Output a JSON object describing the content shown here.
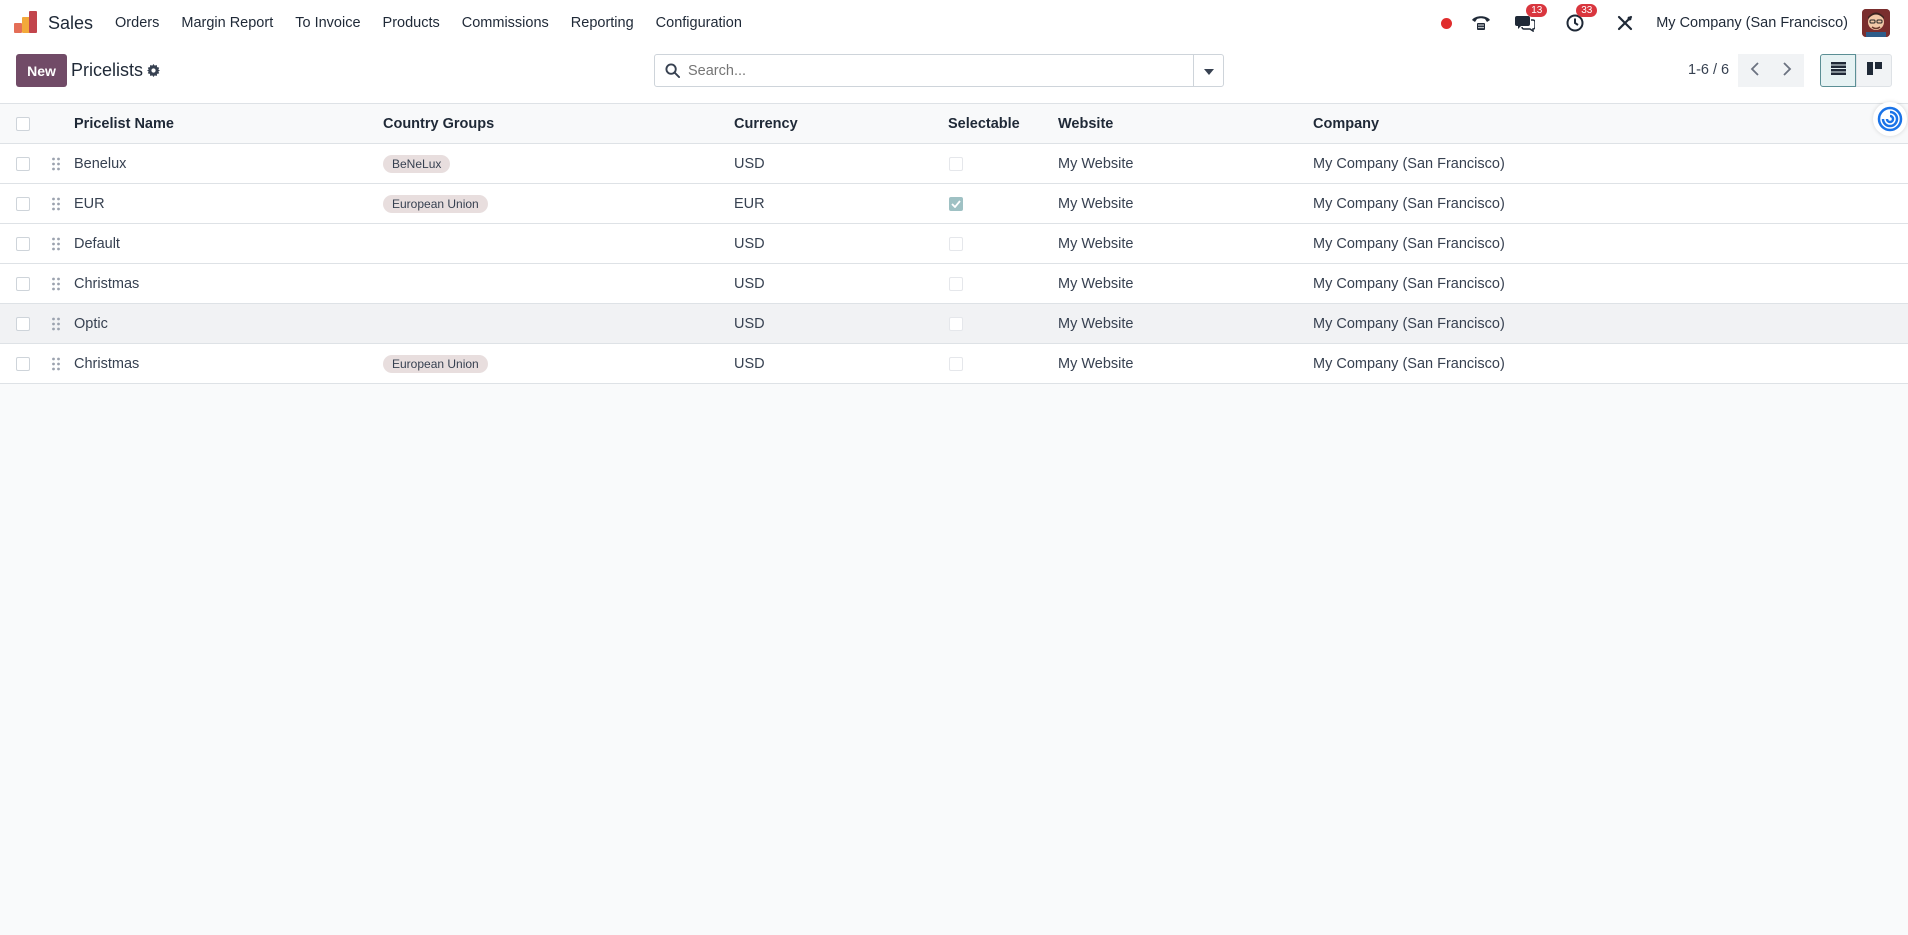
{
  "app": {
    "name": "Sales",
    "logo_icon": "sales-app-logo-icon"
  },
  "menu": [
    {
      "label": "Orders"
    },
    {
      "label": "Margin Report"
    },
    {
      "label": "To Invoice"
    },
    {
      "label": "Products"
    },
    {
      "label": "Commissions"
    },
    {
      "label": "Reporting"
    },
    {
      "label": "Configuration"
    }
  ],
  "systray": {
    "messages_count": "13",
    "activities_count": "33",
    "company": "My Company (San Francisco)"
  },
  "control": {
    "new_label": "New",
    "breadcrumb": "Pricelists",
    "search_placeholder": "Search...",
    "pager": "1-6 / 6"
  },
  "table": {
    "headers": {
      "name": "Pricelist Name",
      "country_groups": "Country Groups",
      "currency": "Currency",
      "selectable": "Selectable",
      "website": "Website",
      "company": "Company"
    },
    "rows": [
      {
        "name": "Benelux",
        "country_group": "BeNeLux",
        "currency": "USD",
        "selectable": false,
        "website": "My Website",
        "company": "My Company (San Francisco)"
      },
      {
        "name": "EUR",
        "country_group": "European Union",
        "currency": "EUR",
        "selectable": true,
        "website": "My Website",
        "company": "My Company (San Francisco)"
      },
      {
        "name": "Default",
        "country_group": "",
        "currency": "USD",
        "selectable": false,
        "website": "My Website",
        "company": "My Company (San Francisco)"
      },
      {
        "name": "Christmas",
        "country_group": "",
        "currency": "USD",
        "selectable": false,
        "website": "My Website",
        "company": "My Company (San Francisco)"
      },
      {
        "name": "Optic",
        "country_group": "",
        "currency": "USD",
        "selectable": false,
        "website": "My Website",
        "company": "My Company (San Francisco)"
      },
      {
        "name": "Christmas",
        "country_group": "European Union",
        "currency": "USD",
        "selectable": false,
        "website": "My Website",
        "company": "My Company (San Francisco)"
      }
    ]
  },
  "colors": {
    "brand": "#714b67",
    "badge": "#d9363e",
    "tag_bg": "#e8dede"
  }
}
